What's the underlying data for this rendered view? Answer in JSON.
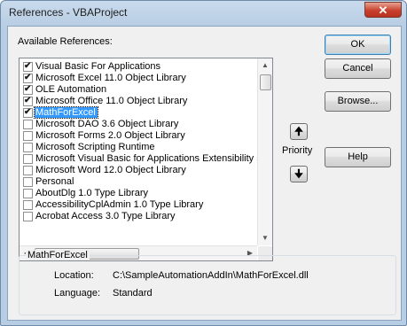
{
  "window": {
    "title": "References - VBAProject",
    "close_glyph": "✕"
  },
  "available_label": "Available References:",
  "references": [
    {
      "label": "Visual Basic For Applications",
      "checked": true,
      "selected": false
    },
    {
      "label": "Microsoft Excel 11.0 Object Library",
      "checked": true,
      "selected": false
    },
    {
      "label": "OLE Automation",
      "checked": true,
      "selected": false
    },
    {
      "label": "Microsoft Office 11.0 Object Library",
      "checked": true,
      "selected": false
    },
    {
      "label": "MathForExcel",
      "checked": true,
      "selected": true
    },
    {
      "label": "Microsoft DAO 3.6 Object Library",
      "checked": false,
      "selected": false
    },
    {
      "label": "Microsoft Forms 2.0 Object Library",
      "checked": false,
      "selected": false
    },
    {
      "label": "Microsoft Scripting Runtime",
      "checked": false,
      "selected": false
    },
    {
      "label": "Microsoft Visual Basic for Applications Extensibility 5.3",
      "checked": false,
      "selected": false
    },
    {
      "label": "Microsoft Word 12.0 Object Library",
      "checked": false,
      "selected": false
    },
    {
      "label": "Personal",
      "checked": false,
      "selected": false
    },
    {
      "label": "AboutDlg 1.0 Type Library",
      "checked": false,
      "selected": false
    },
    {
      "label": "AccessibilityCplAdmin 1.0 Type Library",
      "checked": false,
      "selected": false
    },
    {
      "label": "Acrobat Access 3.0 Type Library",
      "checked": false,
      "selected": false
    }
  ],
  "buttons": {
    "ok": "OK",
    "cancel": "Cancel",
    "browse": "Browse...",
    "help": "Help"
  },
  "priority": {
    "label": "Priority",
    "up_glyph": "🠉",
    "down_glyph": "🠋"
  },
  "details": {
    "group_title": "MathForExcel",
    "location_label": "Location:",
    "location_value": "C:\\SampleAutomationAddIn\\MathForExcel.dll",
    "language_label": "Language:",
    "language_value": "Standard"
  },
  "scroll_glyphs": {
    "up": "▲",
    "down": "▼",
    "left": "◀",
    "right": "▶"
  },
  "colors": {
    "selection": "#3399ff",
    "close_button": "#c8412f",
    "title_bar": "#b7cde3"
  }
}
